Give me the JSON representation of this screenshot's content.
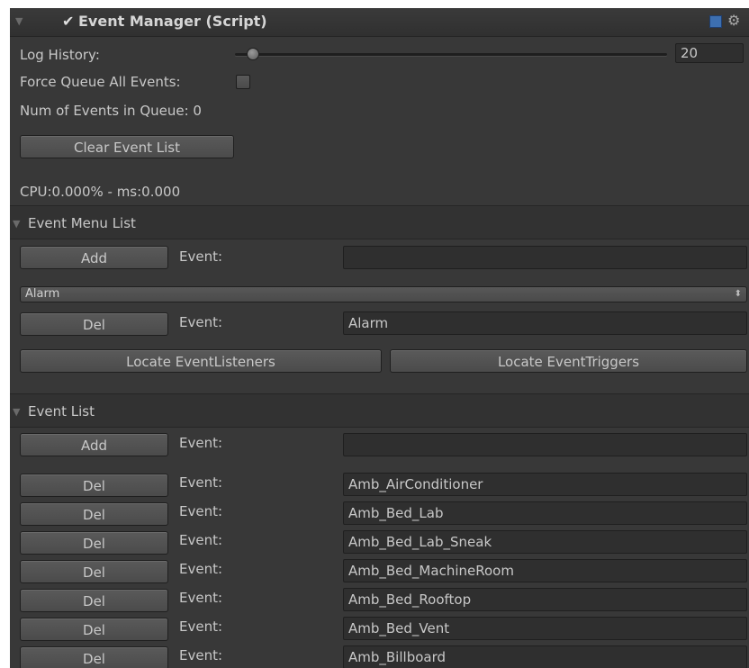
{
  "component": {
    "title": "Event Manager (Script)",
    "enabled_mark": "✔"
  },
  "log_history": {
    "label": "Log History:",
    "value": "20",
    "slider_fraction": 0.02
  },
  "force_queue": {
    "label": "Force Queue All Events:",
    "checked": false
  },
  "queue_count": {
    "text": "Num of Events in Queue: 0"
  },
  "clear_button": {
    "label": "Clear Event List"
  },
  "cpu": {
    "text": "CPU:0.000% - ms:0.000"
  },
  "menu_list": {
    "title": "Event Menu List",
    "add_label": "Add",
    "event_label": "Event:",
    "add_value": "",
    "dropdown_value": "Alarm",
    "del_label": "Del",
    "del_value": "Alarm",
    "locate_listeners": "Locate EventListeners",
    "locate_triggers": "Locate EventTriggers"
  },
  "event_list": {
    "title": "Event List",
    "add_label": "Add",
    "event_label": "Event:",
    "add_value": "",
    "del_label": "Del",
    "items": [
      "Amb_AirConditioner",
      "Amb_Bed_Lab",
      "Amb_Bed_Lab_Sneak",
      "Amb_Bed_MachineRoom",
      "Amb_Bed_Rooftop",
      "Amb_Bed_Vent",
      "Amb_Billboard"
    ]
  }
}
